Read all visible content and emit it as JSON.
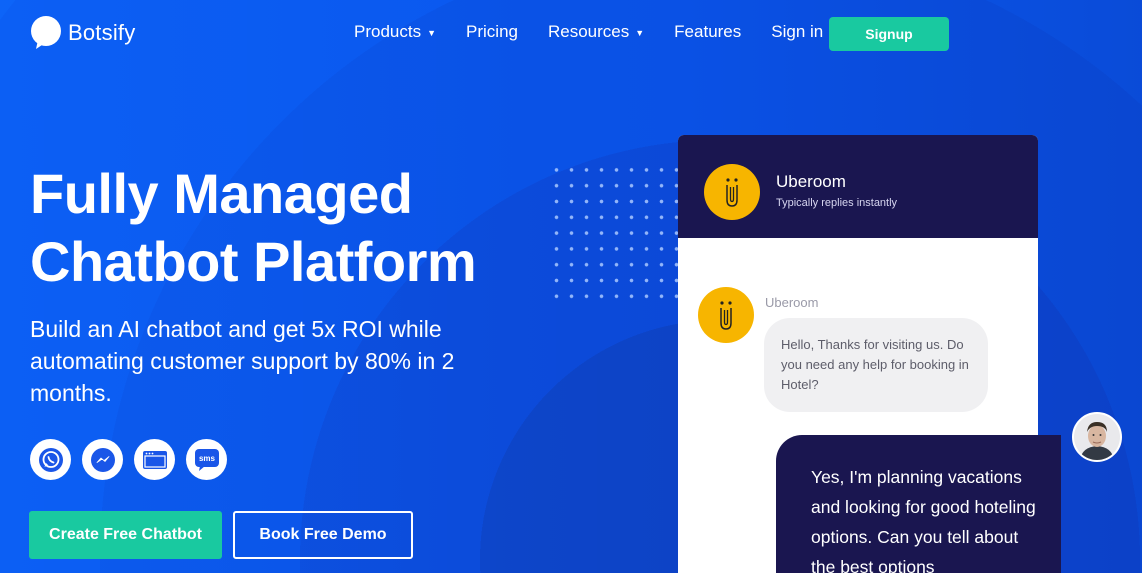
{
  "brand": {
    "name": "Botsify"
  },
  "nav": {
    "items": [
      {
        "label": "Products",
        "dropdown": true
      },
      {
        "label": "Pricing",
        "dropdown": false
      },
      {
        "label": "Resources",
        "dropdown": true
      },
      {
        "label": "Features",
        "dropdown": false
      },
      {
        "label": "Sign in",
        "dropdown": false
      }
    ],
    "signup_label": "Signup"
  },
  "hero": {
    "title_line1": "Fully Managed",
    "title_line2": "Chatbot Platform",
    "subtitle": "Build an AI chatbot and get 5x ROI while automating customer support by 80% in 2 months.",
    "channels": [
      "whatsapp-icon",
      "messenger-icon",
      "web-chat-icon",
      "sms-icon"
    ],
    "sms_text": "sms",
    "create_label": "Create Free Chatbot",
    "demo_label": "Book Free Demo"
  },
  "chat": {
    "bot_name": "Uberoom",
    "status": "Typically replies instantly",
    "message_sender": "Uberoom",
    "bot_message": "Hello, Thanks for visiting us. Do you need any help for booking in Hotel?",
    "user_message": "Yes, I'm planning vacations and looking for good hoteling options. Can you tell about the best options"
  },
  "colors": {
    "accent": "#19c9a0",
    "background": "#0a57ee",
    "chat_header": "#1a1650",
    "bot_avatar": "#f7b500"
  }
}
